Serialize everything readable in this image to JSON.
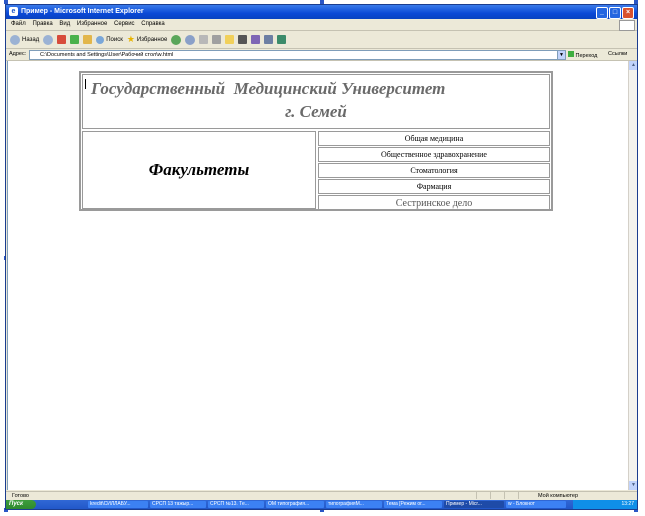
{
  "window": {
    "title": "Пример - Microsoft Internet Explorer"
  },
  "menu": [
    "Файл",
    "Правка",
    "Вид",
    "Избранное",
    "Сервис",
    "Справка"
  ],
  "toolbar": {
    "back": "Назад",
    "search": "Поиск",
    "favorites": "Избранное"
  },
  "address": {
    "label": "Адрес:",
    "value": "C:\\Documents and Settings\\User\\Рабочий стол\\w.html",
    "go": "Переход",
    "links": "Ссылки"
  },
  "page": {
    "title_line1": "Государственный  Медицинский Университет",
    "title_line2": "г. Семей",
    "faculties_label": "Факультеты",
    "faculties": [
      "Общая медицина",
      "Общественное здравохранение",
      "Стоматология",
      "Фармация",
      "Сестринское дело"
    ]
  },
  "status": {
    "text": "Готово",
    "zone": "Мой компьютер"
  },
  "taskbar": {
    "start": "Пуск",
    "tasks": [
      "kredit\\СИЛЛАБУ...",
      "СРСП 13 тажыр...",
      "СРСП №13. Те...",
      "ОМ типография...",
      "типографияМ...",
      "Тема [Режим ог...",
      "Пример - Micr...",
      "w - Блокнот"
    ],
    "clock": "13:27"
  }
}
